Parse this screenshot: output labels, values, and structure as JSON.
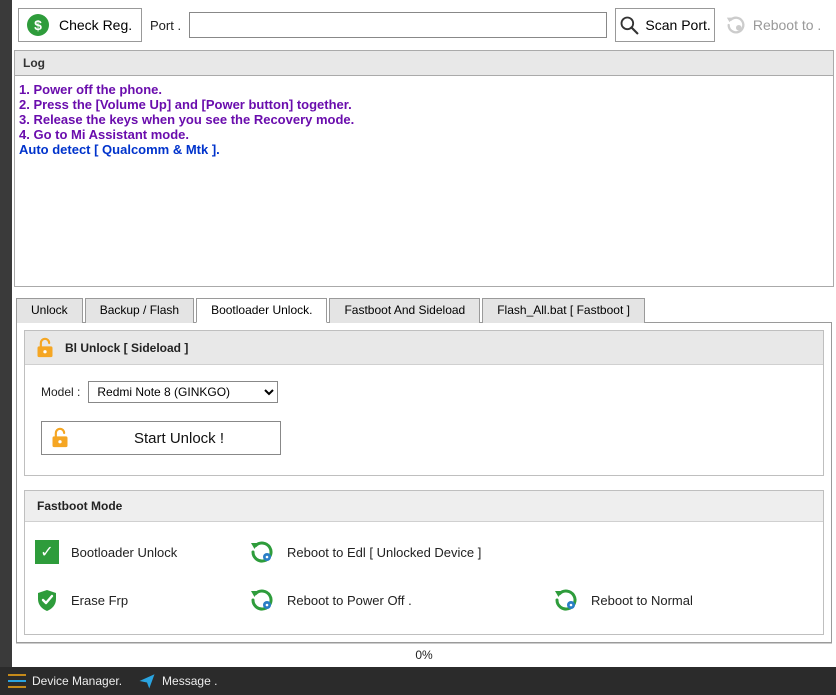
{
  "toolbar": {
    "check_reg_label": "Check Reg.",
    "port_label": "Port .",
    "port_value": "",
    "scan_port_label": "Scan Port.",
    "reboot_to_label": "Reboot to ."
  },
  "log": {
    "header": "Log",
    "lines": [
      {
        "text": "1. Power off the phone.",
        "cls": "purple"
      },
      {
        "text": "2. Press the [Volume Up] and [Power button] together.",
        "cls": "purple"
      },
      {
        "text": "3. Release the keys when you see the Recovery mode.",
        "cls": "purple"
      },
      {
        "text": "4. Go to Mi Assistant mode.",
        "cls": "purple"
      },
      {
        "text": "Auto detect  [ Qualcomm & Mtk ].",
        "cls": "blue"
      }
    ]
  },
  "tabs": {
    "items": [
      {
        "label": "Unlock"
      },
      {
        "label": "Backup / Flash"
      },
      {
        "label": "Bootloader Unlock."
      },
      {
        "label": "Fastboot And Sideload"
      },
      {
        "label": "Flash_All.bat [ Fastboot ]"
      }
    ],
    "active_index": 2
  },
  "bl_unlock": {
    "header": "Bl Unlock [ Sideload ]",
    "model_label": "Model :",
    "model_value": "Redmi Note 8 (GINKGO)",
    "start_label": "Start Unlock !"
  },
  "fastboot": {
    "header": "Fastboot Mode",
    "items": {
      "bootloader_unlock": "Bootloader Unlock",
      "reboot_edl": "Reboot to Edl [ Unlocked Device ]",
      "erase_frp": "Erase Frp",
      "reboot_power_off": "Reboot to Power Off .",
      "reboot_normal": "Reboot to Normal"
    }
  },
  "progress": {
    "label": "0%"
  },
  "statusbar": {
    "device_manager": "Device Manager.",
    "message": "Message ."
  },
  "colors": {
    "accent_green": "#2e9c3b",
    "accent_orange": "#f5a623"
  }
}
